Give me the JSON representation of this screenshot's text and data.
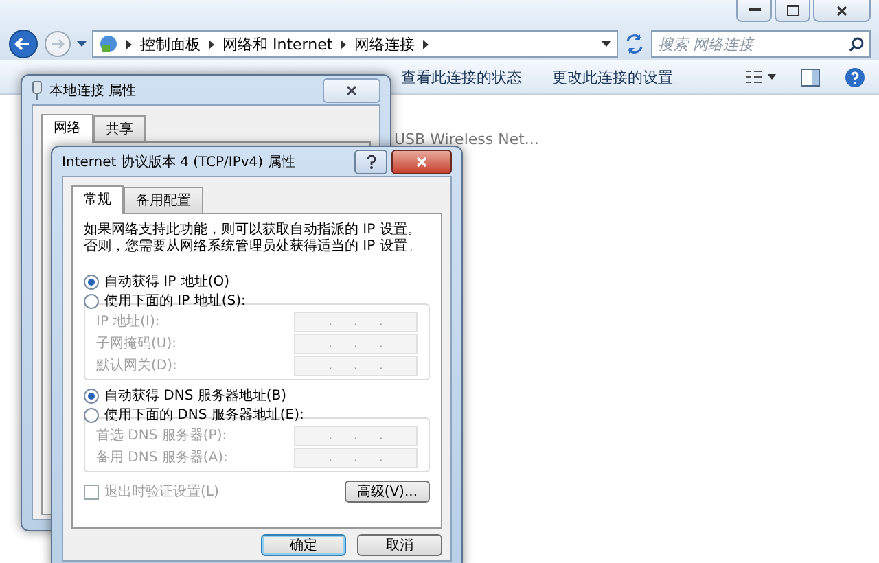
{
  "explorer": {
    "breadcrumb": [
      "控制面板",
      "网络和 Internet",
      "网络连接"
    ],
    "search": {
      "placeholder": "搜索 网络连接"
    },
    "toolbar": [
      "查看此连接的状态",
      "更改此连接的设置"
    ],
    "items": [
      {
        "label": "USB Wireless Net..."
      }
    ]
  },
  "back_dialog": {
    "title": "本地连接 属性",
    "tabs": [
      {
        "label": "网络",
        "selected": true
      },
      {
        "label": "共享",
        "selected": false
      }
    ]
  },
  "dialog": {
    "title": "Internet 协议版本 4 (TCP/IPv4) 属性",
    "tabs": [
      {
        "label": "常规",
        "selected": true
      },
      {
        "label": "备用配置",
        "selected": false
      }
    ],
    "intro": "如果网络支持此功能，则可以获取自动指派的 IP 设置。否则，您需要从网络系统管理员处获得适当的 IP 设置。",
    "ip_options": [
      {
        "label": "自动获得 IP 地址(O)",
        "selected": true
      },
      {
        "label": "使用下面的 IP 地址(S):",
        "selected": false
      }
    ],
    "ip_fields": [
      {
        "label": "IP 地址(I):",
        "value": ". . .",
        "disabled": true
      },
      {
        "label": "子网掩码(U):",
        "value": ". . .",
        "disabled": true
      },
      {
        "label": "默认网关(D):",
        "value": ". . .",
        "disabled": true
      }
    ],
    "dns_options": [
      {
        "label": "自动获得 DNS 服务器地址(B)",
        "selected": true
      },
      {
        "label": "使用下面的 DNS 服务器地址(E):",
        "selected": false
      }
    ],
    "dns_fields": [
      {
        "label": "首选 DNS 服务器(P):",
        "value": ". . .",
        "disabled": true
      },
      {
        "label": "备用 DNS 服务器(A):",
        "value": ". . .",
        "disabled": true
      }
    ],
    "validate": {
      "label": "退出时验证设置(L)",
      "checked": false,
      "disabled": true
    },
    "advanced": "高级(V)...",
    "buttons": [
      {
        "label": "确定",
        "kind": "default"
      },
      {
        "label": "取消",
        "kind": "normal"
      }
    ]
  }
}
